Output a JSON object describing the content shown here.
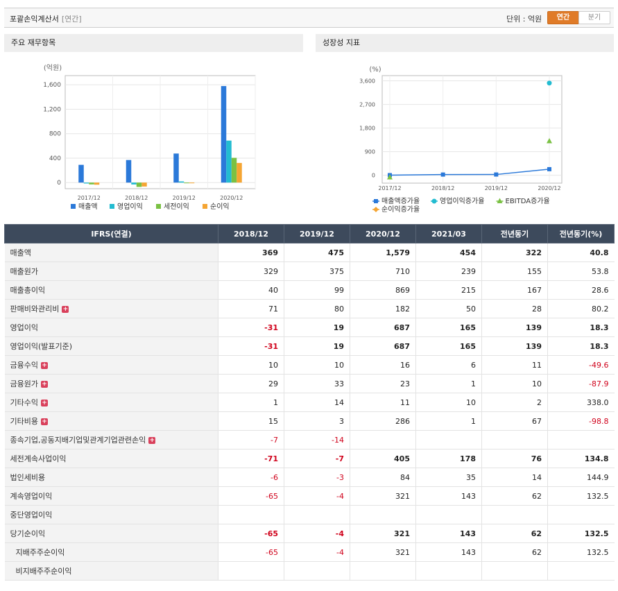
{
  "header": {
    "title": "포괄손익계산서",
    "subtitle": "[연간]",
    "unit_label": "단위 : 억원",
    "tab_annual": "연간",
    "tab_quarter": "분기"
  },
  "colors": {
    "accent": "#e07b28",
    "table_header": "#3d4a5c",
    "negative": "#d0021b"
  },
  "panels": {
    "left_title": "주요 재무항목",
    "right_title": "성장성 지표"
  },
  "chart_data": [
    {
      "type": "bar",
      "unit": "(억원)",
      "categories": [
        "2017/12",
        "2018/12",
        "2019/12",
        "2020/12"
      ],
      "y_ticks": [
        "1,600",
        "1,200",
        "800",
        "400",
        "0"
      ],
      "ylim": [
        -100,
        1750
      ],
      "grid": true,
      "legend_position": "bottom",
      "series": [
        {
          "name": "매출액",
          "color": "#2b79d9",
          "values": [
            290,
            369,
            475,
            1579
          ]
        },
        {
          "name": "영업이익",
          "color": "#23bcd1",
          "values": [
            -15,
            -31,
            19,
            687
          ]
        },
        {
          "name": "세전이익",
          "color": "#7ac143",
          "values": [
            -30,
            -71,
            -7,
            405
          ]
        },
        {
          "name": "순이익",
          "color": "#f5a533",
          "values": [
            -35,
            -65,
            -4,
            321
          ]
        }
      ]
    },
    {
      "type": "line",
      "unit": "(%)",
      "categories": [
        "2017/12",
        "2018/12",
        "2019/12",
        "2020/12"
      ],
      "y_ticks": [
        "3,600",
        "2,700",
        "1,800",
        "900",
        "0"
      ],
      "ylim": [
        -300,
        3800
      ],
      "grid": true,
      "legend_position": "bottom",
      "series": [
        {
          "name": "매출액증가율",
          "color": "#2b79d9",
          "marker": "square",
          "values": [
            5,
            27,
            29,
            232
          ]
        },
        {
          "name": "영업이익증가율",
          "color": "#23bcd1",
          "marker": "circle",
          "values": [
            null,
            null,
            null,
            3515
          ]
        },
        {
          "name": "EBITDA증가율",
          "color": "#7ac143",
          "marker": "triangle",
          "values": [
            -80,
            null,
            null,
            1300
          ]
        },
        {
          "name": "순이익증가율",
          "color": "#f5a533",
          "marker": "diamond",
          "values": [
            null,
            null,
            null,
            null
          ]
        }
      ]
    }
  ],
  "table": {
    "columns": [
      "IFRS(연결)",
      "2018/12",
      "2019/12",
      "2020/12",
      "2021/03",
      "전년동기",
      "전년동기(%)"
    ],
    "rows": [
      {
        "label": "매출액",
        "bold": true,
        "expand": false,
        "values": [
          "369",
          "475",
          "1,579",
          "454",
          "322",
          "40.8"
        ]
      },
      {
        "label": "매출원가",
        "bold": false,
        "expand": false,
        "values": [
          "329",
          "375",
          "710",
          "239",
          "155",
          "53.8"
        ]
      },
      {
        "label": "매출총이익",
        "bold": false,
        "expand": false,
        "values": [
          "40",
          "99",
          "869",
          "215",
          "167",
          "28.6"
        ]
      },
      {
        "label": "판매비와관리비",
        "bold": false,
        "expand": true,
        "values": [
          "71",
          "80",
          "182",
          "50",
          "28",
          "80.2"
        ]
      },
      {
        "label": "영업이익",
        "bold": true,
        "expand": false,
        "values": [
          "-31",
          "19",
          "687",
          "165",
          "139",
          "18.3"
        ]
      },
      {
        "label": "영업이익(발표기준)",
        "bold": true,
        "expand": false,
        "values": [
          "-31",
          "19",
          "687",
          "165",
          "139",
          "18.3"
        ]
      },
      {
        "label": "금융수익",
        "bold": false,
        "expand": true,
        "values": [
          "10",
          "10",
          "16",
          "6",
          "11",
          "-49.6"
        ]
      },
      {
        "label": "금융원가",
        "bold": false,
        "expand": true,
        "values": [
          "29",
          "33",
          "23",
          "1",
          "10",
          "-87.9"
        ]
      },
      {
        "label": "기타수익",
        "bold": false,
        "expand": true,
        "values": [
          "1",
          "14",
          "11",
          "10",
          "2",
          "338.0"
        ]
      },
      {
        "label": "기타비용",
        "bold": false,
        "expand": true,
        "values": [
          "15",
          "3",
          "286",
          "1",
          "67",
          "-98.8"
        ]
      },
      {
        "label": "종속기업,공동지배기업및관계기업관련손익",
        "bold": false,
        "expand": true,
        "values": [
          "-7",
          "-14",
          "",
          "",
          "",
          ""
        ]
      },
      {
        "label": "세전계속사업이익",
        "bold": true,
        "expand": false,
        "values": [
          "-71",
          "-7",
          "405",
          "178",
          "76",
          "134.8"
        ]
      },
      {
        "label": "법인세비용",
        "bold": false,
        "expand": false,
        "values": [
          "-6",
          "-3",
          "84",
          "35",
          "14",
          "144.9"
        ]
      },
      {
        "label": "계속영업이익",
        "bold": false,
        "expand": false,
        "values": [
          "-65",
          "-4",
          "321",
          "143",
          "62",
          "132.5"
        ]
      },
      {
        "label": "중단영업이익",
        "bold": false,
        "expand": false,
        "values": [
          "",
          "",
          "",
          "",
          "",
          ""
        ]
      },
      {
        "label": "당기순이익",
        "bold": true,
        "expand": false,
        "values": [
          "-65",
          "-4",
          "321",
          "143",
          "62",
          "132.5"
        ]
      },
      {
        "label": "지배주주순이익",
        "bold": false,
        "expand": false,
        "indent": true,
        "values": [
          "-65",
          "-4",
          "321",
          "143",
          "62",
          "132.5"
        ]
      },
      {
        "label": "비지배주주순이익",
        "bold": false,
        "expand": false,
        "indent": true,
        "values": [
          "",
          "",
          "",
          "",
          "",
          ""
        ]
      }
    ]
  }
}
